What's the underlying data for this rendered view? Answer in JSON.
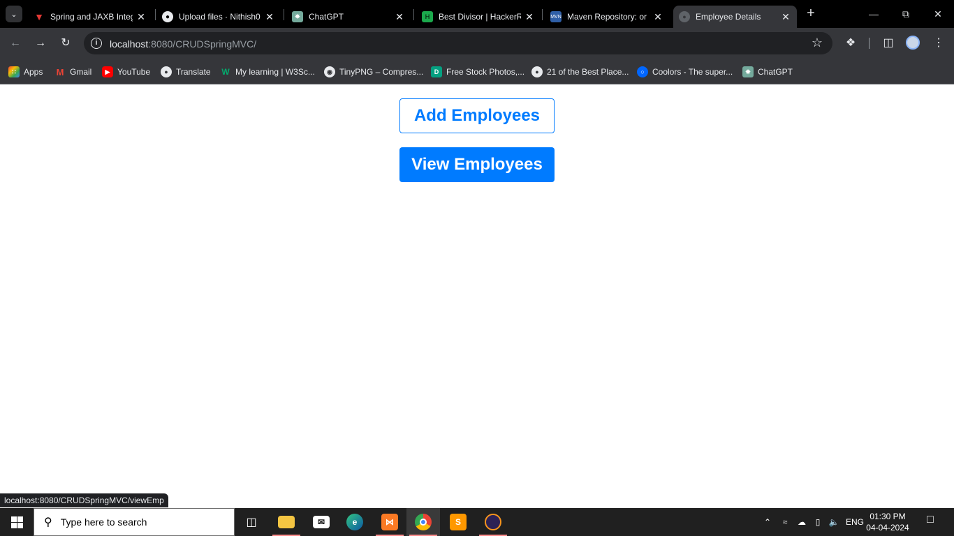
{
  "browser": {
    "tabs": [
      {
        "title": "Spring and JAXB Integ",
        "icon": "red-v-icon",
        "active": false
      },
      {
        "title": "Upload files · Nithish0",
        "icon": "github-icon",
        "active": false
      },
      {
        "title": "ChatGPT",
        "icon": "chatgpt-icon",
        "active": false
      },
      {
        "title": "Best Divisor | HackerR",
        "icon": "hackerrank-icon",
        "active": false
      },
      {
        "title": "Maven Repository: or",
        "icon": "maven-icon",
        "active": false
      },
      {
        "title": "Employee Details",
        "icon": "globe-icon",
        "active": true
      }
    ],
    "address": {
      "host": "localhost",
      "rest": ":8080/CRUDSpringMVC/"
    },
    "bookmarks": [
      {
        "label": "Apps",
        "color": "#ea4335"
      },
      {
        "label": "Gmail",
        "color": "#ea4335"
      },
      {
        "label": "YouTube",
        "color": "#ff0000"
      },
      {
        "label": "Translate",
        "color": "#e8eaed"
      },
      {
        "label": "My learning | W3Sc...",
        "color": "#04aa6d"
      },
      {
        "label": "TinyPNG – Compres...",
        "color": "#e8eaed"
      },
      {
        "label": "Free Stock Photos,...",
        "color": "#05a081"
      },
      {
        "label": "21 of the Best Place...",
        "color": "#e8eaed"
      },
      {
        "label": "Coolors - The super...",
        "color": "#0066ff"
      },
      {
        "label": "ChatGPT",
        "color": "#74aa9c"
      }
    ]
  },
  "page": {
    "add_button": "Add Employees",
    "view_button": "View Employees",
    "status_url": "localhost:8080/CRUDSpringMVC/viewEmp"
  },
  "taskbar": {
    "search_placeholder": "Type here to search",
    "language": "ENG",
    "time": "01:30 PM",
    "date": "04-04-2024"
  }
}
